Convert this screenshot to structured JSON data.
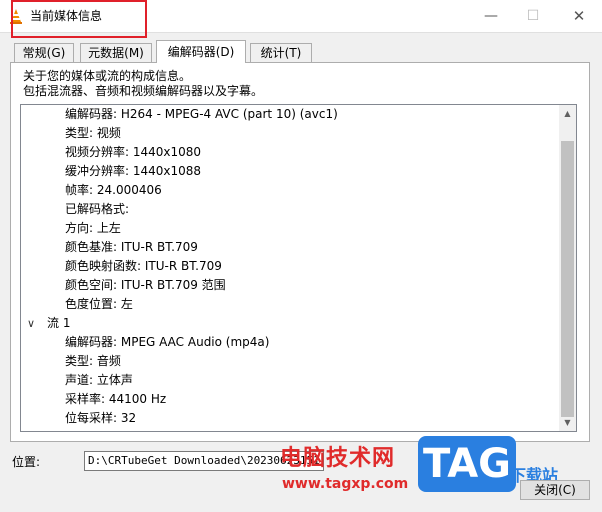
{
  "window": {
    "title": "当前媒体信息",
    "minimize_glyph": "—",
    "maximize_glyph": "☐",
    "close_glyph": "✕"
  },
  "tabs": [
    {
      "label": "常规(G)",
      "active": false
    },
    {
      "label": "元数据(M)",
      "active": false
    },
    {
      "label": "编解码器(D)",
      "active": true
    },
    {
      "label": "统计(T)",
      "active": false
    }
  ],
  "codec_panel": {
    "description_line1": "关于您的媒体或流的构成信息。",
    "description_line2": "包括混流器、音频和视频编解码器以及字幕。",
    "rows": [
      {
        "level": "child",
        "text": "编解码器: H264 - MPEG-4 AVC (part 10) (avc1)"
      },
      {
        "level": "child",
        "text": "类型: 视频"
      },
      {
        "level": "child",
        "text": "视频分辨率: 1440x1080"
      },
      {
        "level": "child",
        "text": "缓冲分辨率: 1440x1088"
      },
      {
        "level": "child",
        "text": "帧率: 24.000406"
      },
      {
        "level": "child",
        "text": "已解码格式:"
      },
      {
        "level": "child",
        "text": "方向: 上左"
      },
      {
        "level": "child",
        "text": "颜色基准: ITU-R BT.709"
      },
      {
        "level": "child",
        "text": "颜色映射函数: ITU-R BT.709"
      },
      {
        "level": "child",
        "text": "颜色空间: ITU-R BT.709 范围"
      },
      {
        "level": "child",
        "text": "色度位置: 左"
      },
      {
        "level": "parent",
        "text": "流 1",
        "expanded": true
      },
      {
        "level": "child",
        "text": "编解码器: MPEG AAC Audio (mp4a)"
      },
      {
        "level": "child",
        "text": "类型: 音频"
      },
      {
        "level": "child",
        "text": "声道: 立体声"
      },
      {
        "level": "child",
        "text": "采样率: 44100 Hz"
      },
      {
        "level": "child",
        "text": "位每采样: 32"
      }
    ]
  },
  "location": {
    "label": "位置:",
    "value": "D:\\CRTubeGet Downloaded\\20230623151..."
  },
  "close_button": {
    "label": "关闭(C)"
  },
  "watermark": {
    "site_name": "电脑技术网",
    "url": "www.tagxp.com",
    "logo_text": "TAG",
    "side_text": "下载站"
  },
  "colors": {
    "highlight_border": "#e0202a",
    "watermark_red": "#e02b2b",
    "watermark_blue": "#2a7fe0"
  },
  "icons": {
    "app": "vlc-cone-icon",
    "tree_toggle": "chevron-down-icon",
    "scroll_up": "scroll-up-arrow-icon",
    "scroll_down": "scroll-down-arrow-icon"
  }
}
